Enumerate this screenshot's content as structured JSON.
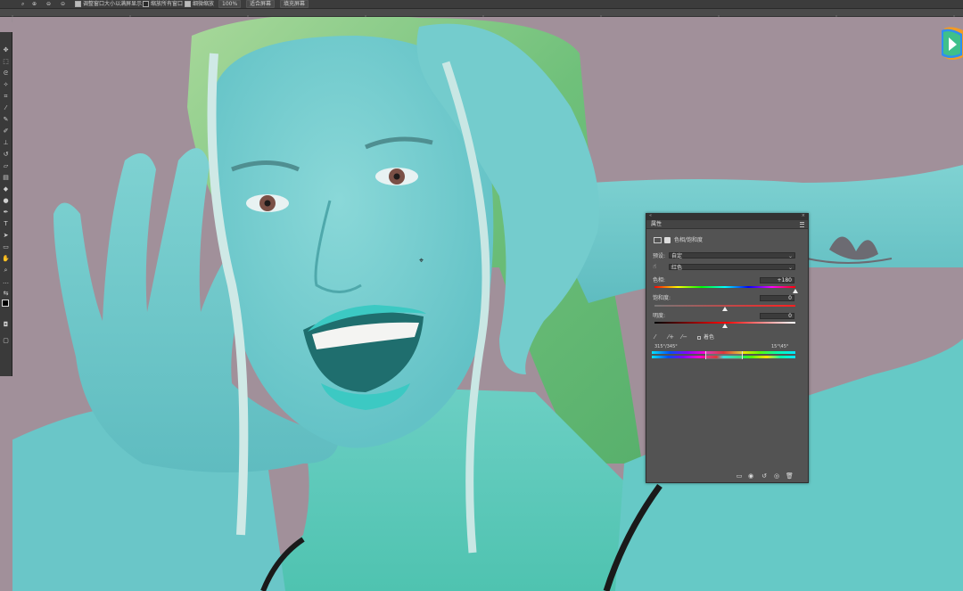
{
  "options_bar": {
    "zoom_icon": "zoom-icon",
    "resize_windows_label": "调整窗口大小以满屏显示",
    "resize_windows_checked": true,
    "zoom_all_windows_label": "缩放所有窗口",
    "zoom_all_windows_checked": false,
    "scrubby_zoom_label": "细微缩放",
    "scrubby_zoom_checked": true,
    "zoom_value": "100%",
    "fit_screen_button": "适合屏幕",
    "fill_screen_button": "填充屏幕"
  },
  "properties_panel": {
    "tab_title": "属性",
    "adjustment_title": "色相/饱和度",
    "preset_label": "预设:",
    "preset_value": "自定",
    "channel_value": "红色",
    "hue_label": "色相:",
    "hue_value": "+180",
    "hue_position": 1.0,
    "saturation_label": "饱和度:",
    "saturation_value": "0",
    "saturation_position": 0.5,
    "lightness_label": "明度:",
    "lightness_value": "0",
    "lightness_position": 0.5,
    "colorize_label": "着色",
    "colorize_checked": false,
    "range_left": "315°/345°",
    "range_right": "15°\\45°"
  },
  "colors": {
    "canvas_background": "#a1909a",
    "skin": "#6ec7c9",
    "panel": "#535353"
  }
}
